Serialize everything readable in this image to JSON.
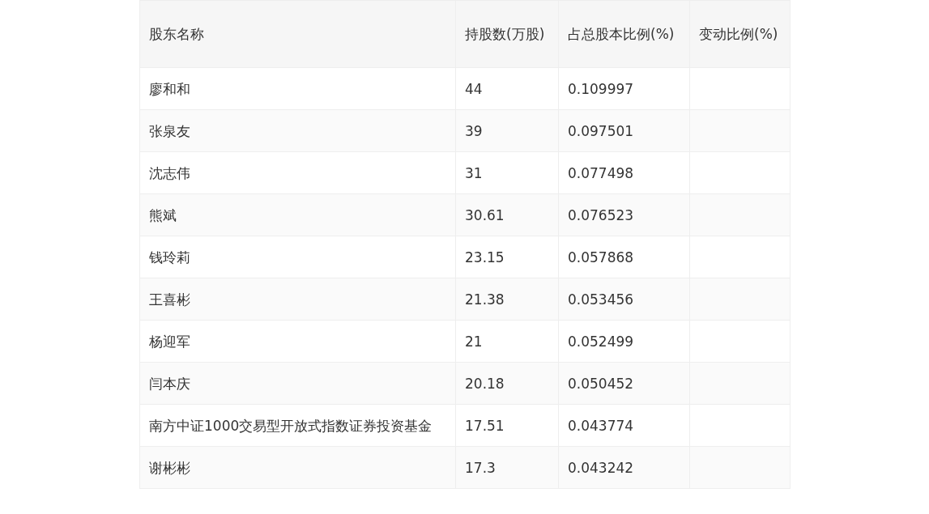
{
  "table": {
    "columns": [
      "股东名称",
      "持股数(万股)",
      "占总股本比例(%)",
      "变动比例(%)"
    ],
    "rows": [
      {
        "cells": [
          "廖和和",
          "44",
          "0.109997",
          ""
        ]
      },
      {
        "cells": [
          "张泉友",
          "39",
          "0.097501",
          ""
        ]
      },
      {
        "cells": [
          "沈志伟",
          "31",
          "0.077498",
          ""
        ]
      },
      {
        "cells": [
          "熊斌",
          "30.61",
          "0.076523",
          ""
        ]
      },
      {
        "cells": [
          "钱玲莉",
          "23.15",
          "0.057868",
          ""
        ]
      },
      {
        "cells": [
          "王喜彬",
          "21.38",
          "0.053456",
          ""
        ]
      },
      {
        "cells": [
          "杨迎军",
          "21",
          "0.052499",
          ""
        ]
      },
      {
        "cells": [
          "闫本庆",
          "20.18",
          "0.050452",
          ""
        ]
      },
      {
        "cells": [
          "南方中证1000交易型开放式指数证券投资基金",
          "17.51",
          "0.043774",
          ""
        ]
      },
      {
        "cells": [
          "谢彬彬",
          "17.3",
          "0.043242",
          ""
        ]
      }
    ]
  }
}
